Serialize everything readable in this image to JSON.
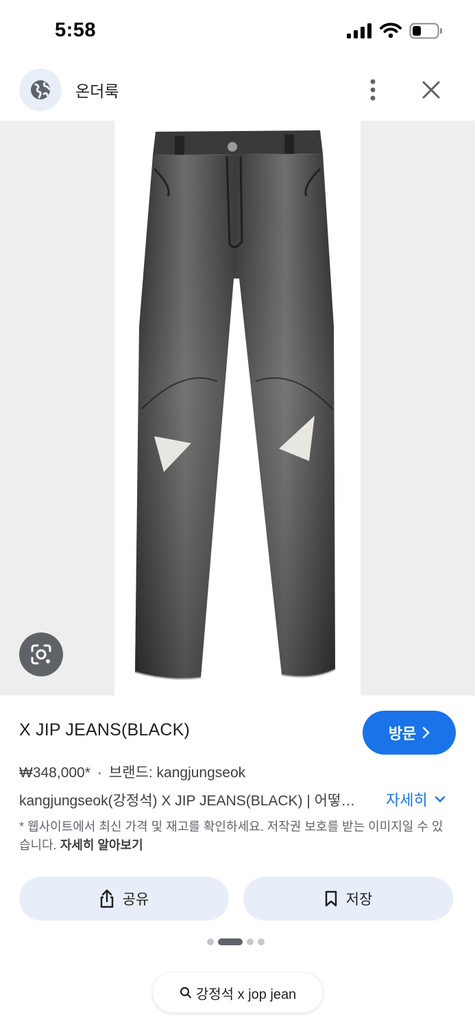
{
  "status_bar": {
    "time": "5:58"
  },
  "header": {
    "site_name": "온더룩"
  },
  "product": {
    "title": "X JIP JEANS(BLACK)",
    "visit_label": "방문",
    "price": "₩348,000*",
    "separator": "·",
    "brand": "브랜드: kangjungseok",
    "description": "kangjungseok(강정석) X JIP JEANS(BLACK) | 어떻…",
    "more_label": "자세히",
    "notice": "* 웹사이트에서 최신 가격 및 재고를 확인하세요. 저작권 보호를 받는 이미지일 수 있습니다.",
    "learn_more": "자세히 알아보기"
  },
  "actions": {
    "share_label": "공유",
    "save_label": "저장"
  },
  "pager": {
    "count": 4,
    "active_index": 1
  },
  "search_chip": {
    "label": "강정석 x jop jean"
  },
  "colors": {
    "accent": "#1a73e8",
    "button_bg": "#e8eef9",
    "image_bg": "#eeeeee"
  },
  "icons": [
    "globe-icon",
    "more-vert-icon",
    "close-icon",
    "lens-icon",
    "share-icon",
    "bookmark-icon",
    "chevron-right-icon",
    "chevron-down-icon",
    "search-icon"
  ]
}
